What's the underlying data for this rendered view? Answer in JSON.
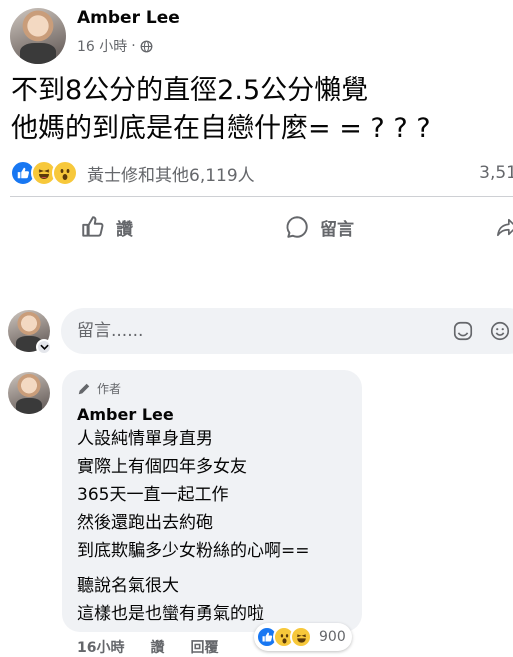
{
  "post": {
    "author": "Amber Lee",
    "time": "16 小時",
    "privacy_icon": "globe-icon",
    "body": "不到8公分的直徑2.5公分懶覺\n他媽的到底是在自戀什麼= = ? ? ?",
    "reactors_text": "黃士修和其他6,119人",
    "comment_count_text": "3,51",
    "reaction_icons": [
      "like-icon",
      "haha-icon",
      "wow-icon"
    ]
  },
  "actions": {
    "like_label": "讚",
    "comment_label": "留言"
  },
  "composer": {
    "placeholder": "留言......"
  },
  "comment": {
    "badge": "作者",
    "author": "Amber Lee",
    "lines": [
      "人設純情單身直男",
      "實際上有個四年多女友",
      "365天一直一起工作",
      "然後還跑出去約砲",
      "到底欺騙多少女粉絲的心啊==",
      "聽說名氣很大",
      "這樣也是也蠻有勇氣的啦"
    ],
    "time": "16小時",
    "like_label": "讚",
    "reply_label": "回覆",
    "reaction_count": "900"
  },
  "colors": {
    "brand_blue": "#1877f2",
    "muted_text": "#65676b",
    "bubble_bg": "#f0f2f5"
  }
}
